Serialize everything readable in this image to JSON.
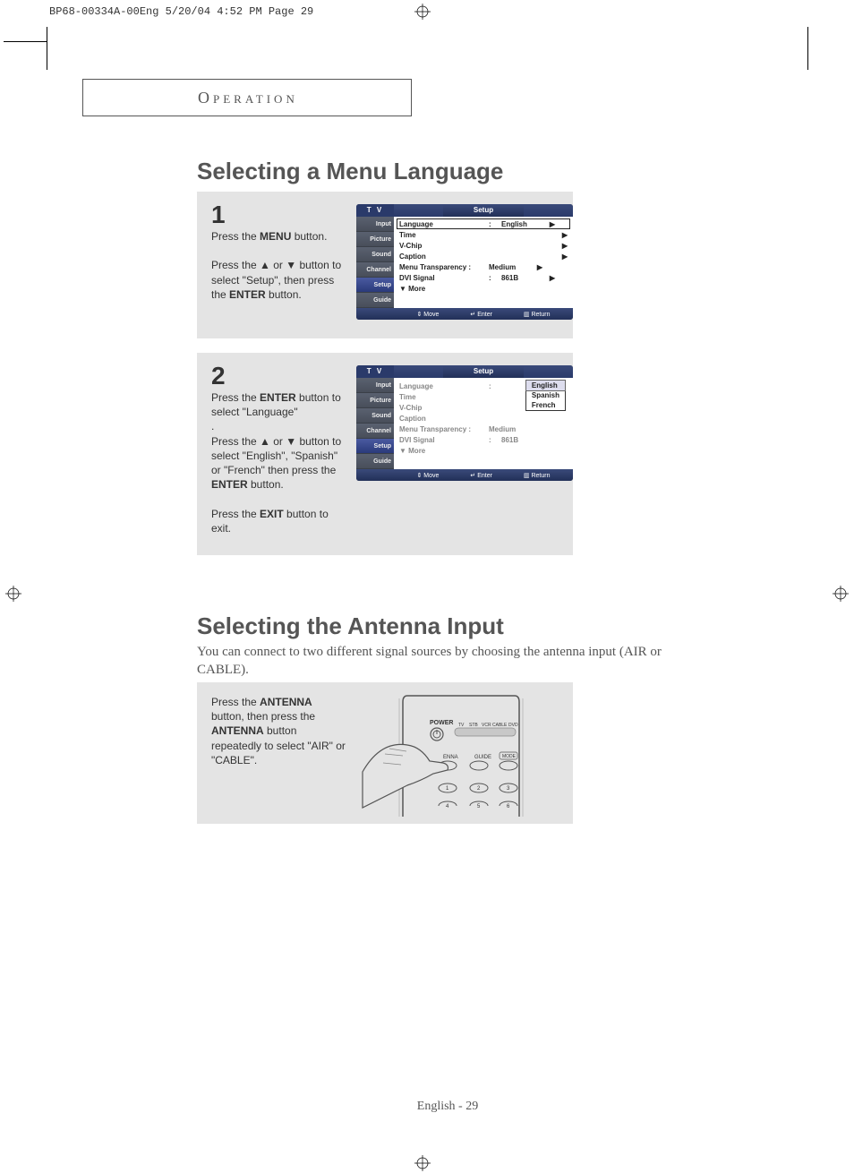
{
  "print_header": "BP68-00334A-00Eng  5/20/04  4:52 PM  Page 29",
  "section_header": "Operation",
  "h2a": "Selecting a Menu Language",
  "h2b": "Selecting the Antenna Input",
  "intro": "You can connect to two different signal sources by choosing the antenna input (AIR or CABLE).",
  "step1": {
    "num": "1",
    "line1a": "Press the ",
    "line1b": "MENU",
    "line1c": " button.",
    "line2a": "Press the ▲ or ▼ button to select \"Setup\", then press the ",
    "line2b": "ENTER",
    "line2c": " button."
  },
  "step2": {
    "num": "2",
    "line1a": "Press the ",
    "line1b": "ENTER",
    "line1c": "  button  to select \"Language\"",
    "dot": ".",
    "line2a": "Press the ▲ or ▼ button to select \"English\", \"Spanish\" or \"French\" then press the ",
    "line2b": "ENTER",
    "line2c": " button.",
    "line3a": "Press the ",
    "line3b": "EXIT",
    "line3c": " button to exit."
  },
  "step3": {
    "line1a": "Press the ",
    "line1b": "ANTENNA",
    "line1c": " button, then press the ",
    "line1d": "ANTENNA",
    "line1e": " button repeatedly to select \"AIR\" or \"CABLE\"."
  },
  "osd": {
    "tv": "T V",
    "title": "Setup",
    "tabs": [
      "Input",
      "Picture",
      "Sound",
      "Channel",
      "Setup",
      "Guide"
    ],
    "rows": {
      "language": "Language",
      "language_val": "English",
      "time": "Time",
      "vchip": "V-Chip",
      "caption": "Caption",
      "menutrans": "Menu Transparency :",
      "menutrans_val": "Medium",
      "dvi": "DVI Signal",
      "dvi_val": "861B",
      "more": "▼ More"
    },
    "colon": ":",
    "foot_move": "Move",
    "foot_enter": "Enter",
    "foot_return": "Return",
    "dropdown": [
      "English",
      "Spanish",
      "French"
    ]
  },
  "remote": {
    "power": "POWER",
    "sources": [
      "TV",
      "STB",
      "VCR",
      "CABLE",
      "DVD"
    ],
    "antenna_btn": "ENNA",
    "guide_btn": "GUIDE",
    "mode_btn": "MODE",
    "nums": [
      "1",
      "2",
      "3",
      "4",
      "5",
      "6"
    ]
  },
  "footer": "English - 29"
}
